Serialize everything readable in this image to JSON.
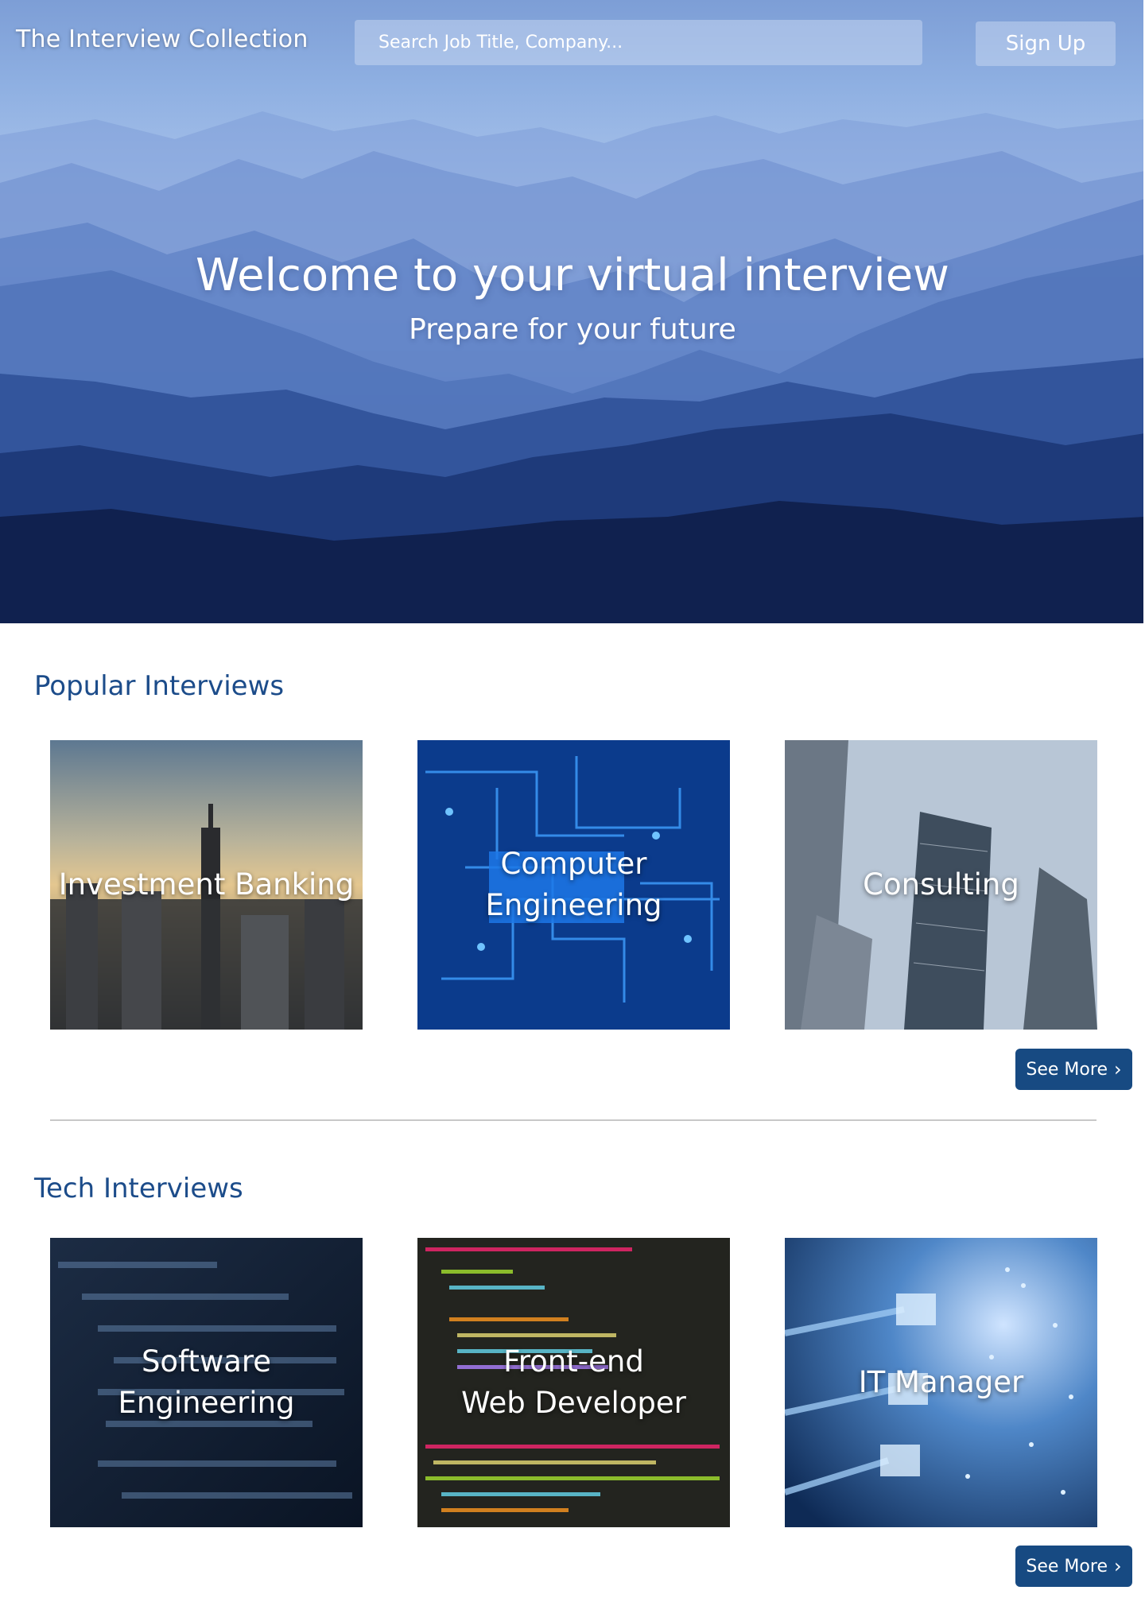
{
  "header": {
    "brand": "The Interview Collection",
    "search_placeholder": "Search Job Title, Company...",
    "signup_label": "Sign Up"
  },
  "hero": {
    "title": "Welcome to your virtual interview",
    "subtitle": "Prepare for your future"
  },
  "sections": [
    {
      "title": "Popular Interviews",
      "cards": [
        {
          "label": "Investment Banking"
        },
        {
          "label": "Computer Engineering"
        },
        {
          "label": "Consulting"
        }
      ],
      "see_more_label": "See More"
    },
    {
      "title": "Tech Interviews",
      "cards": [
        {
          "label": "Software Engineering"
        },
        {
          "label": "Front-end\nWeb Developer"
        },
        {
          "label": "IT Manager"
        }
      ],
      "see_more_label": "See More"
    }
  ],
  "icons": {
    "see_more_chevron": "chevron-right-icon"
  }
}
